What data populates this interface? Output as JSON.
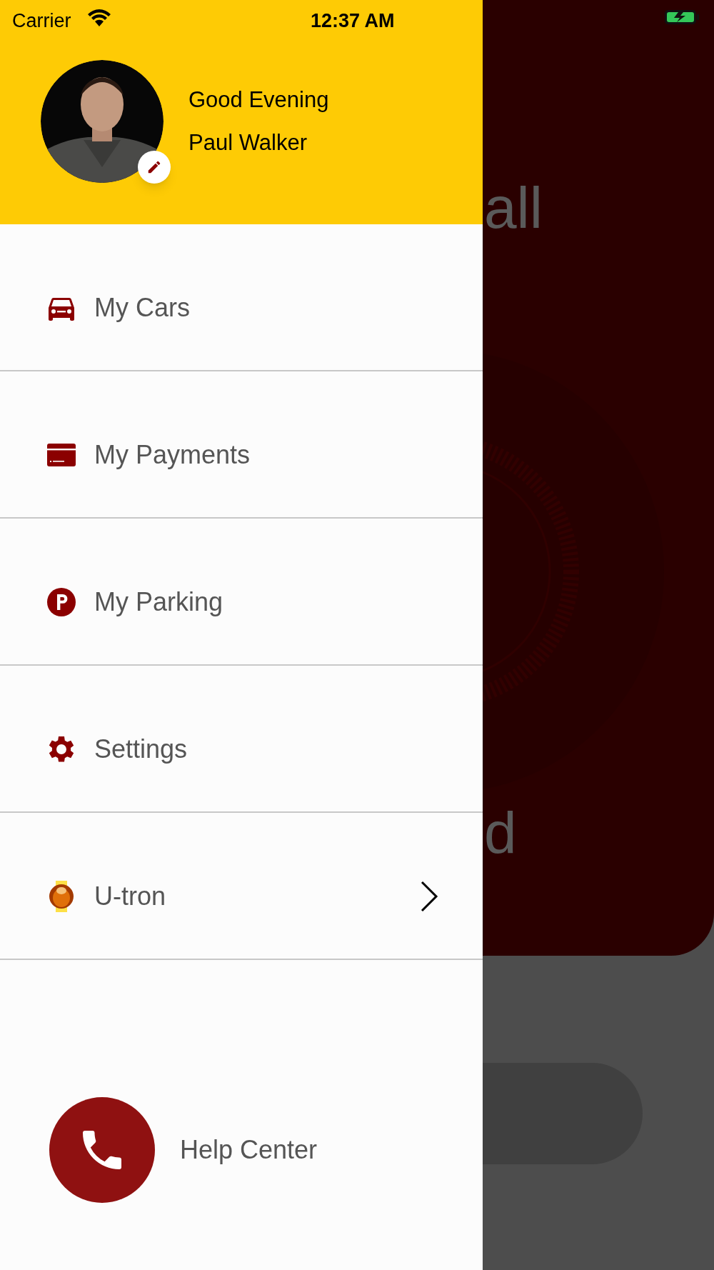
{
  "status_bar": {
    "carrier": "Carrier",
    "time": "12:37 AM"
  },
  "background": {
    "title_fragment": "all",
    "label_fragment": "d"
  },
  "drawer": {
    "greeting": "Good Evening",
    "user_name": "Paul Walker",
    "menu": [
      {
        "label": "My Cars",
        "has_submenu": false
      },
      {
        "label": "My Payments",
        "has_submenu": false
      },
      {
        "label": "My Parking",
        "has_submenu": false
      },
      {
        "label": "Settings",
        "has_submenu": false
      },
      {
        "label": "U-tron",
        "has_submenu": true
      }
    ],
    "help": {
      "label": "Help Center"
    }
  }
}
